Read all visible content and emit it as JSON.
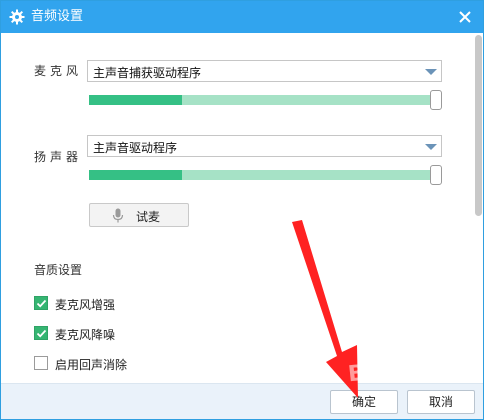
{
  "window": {
    "title": "音频设置",
    "title_icon": "gear-icon",
    "close_icon": "close-icon",
    "accent_color": "#31a4ee"
  },
  "microphone": {
    "label": "麦克风",
    "device": "主声音捕获驱动程序",
    "level_fraction": 0.27
  },
  "speaker": {
    "label": "扬声器",
    "device": "主声音驱动程序",
    "level_fraction": 0.27
  },
  "test_button": {
    "label": "试麦",
    "icon": "microphone-icon"
  },
  "quality": {
    "title": "音质设置",
    "options": [
      {
        "label": "麦克风增强",
        "checked": true
      },
      {
        "label": "麦克风降噪",
        "checked": true
      },
      {
        "label": "启用回声消除",
        "checked": false
      }
    ]
  },
  "footer": {
    "ok_label": "确定",
    "cancel_label": "取消"
  },
  "annotation": {
    "color": "#ff2222"
  },
  "watermark": {
    "text": "Bai du"
  }
}
